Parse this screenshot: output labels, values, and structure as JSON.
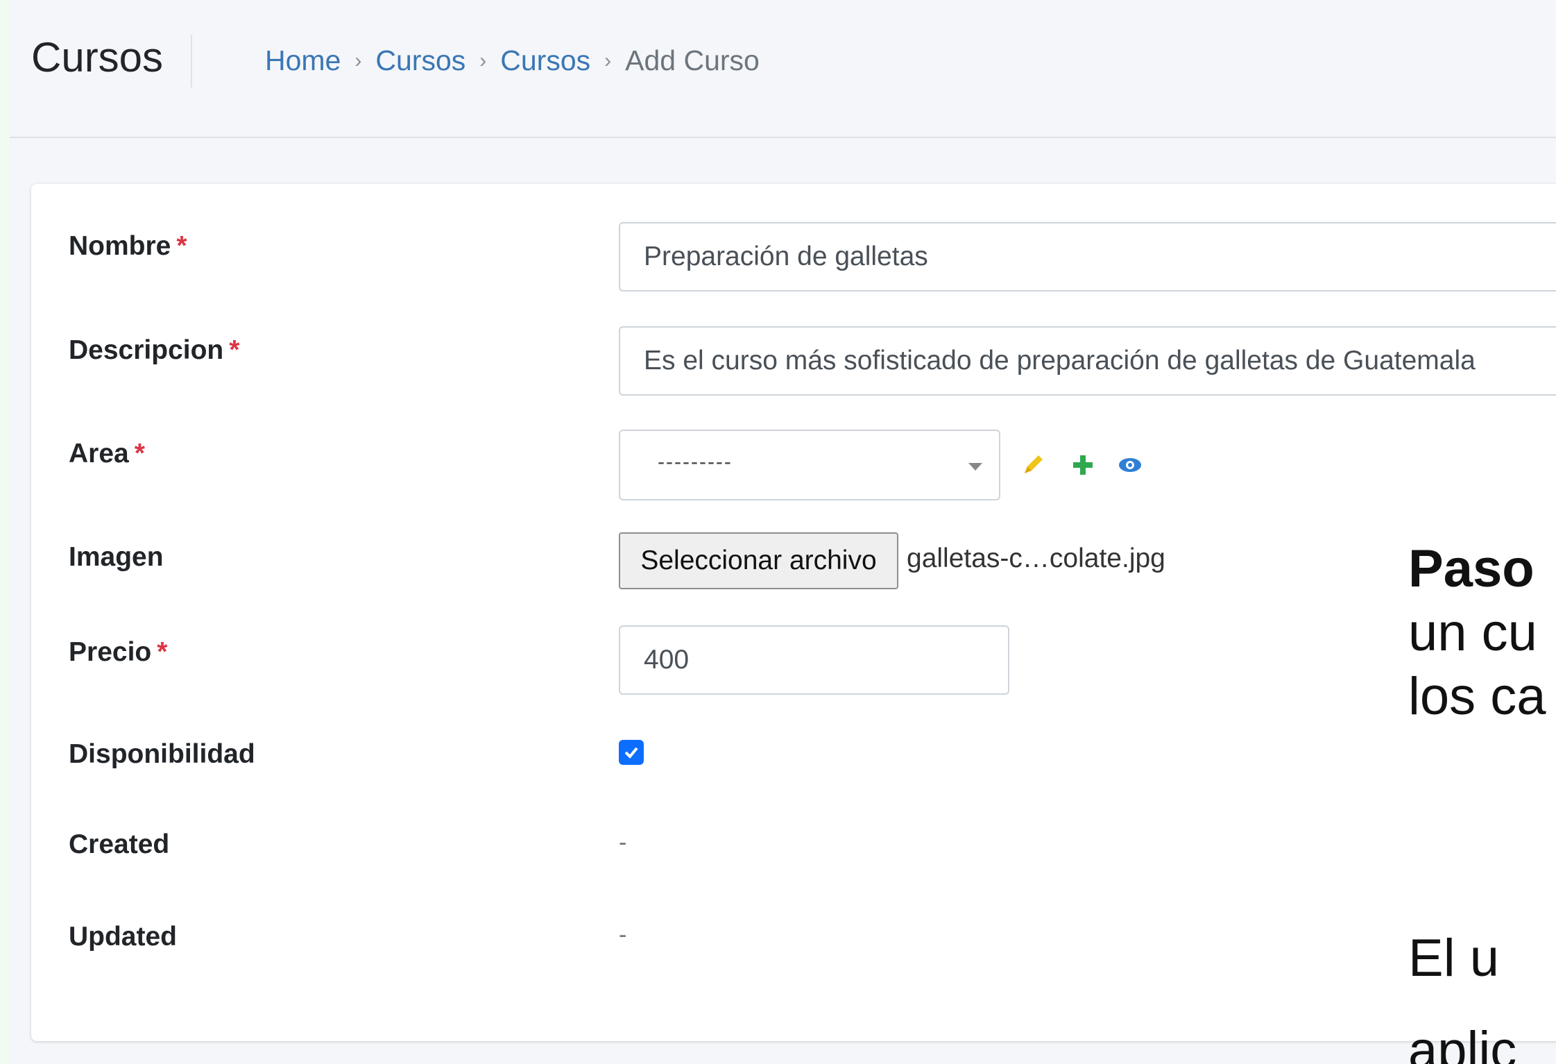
{
  "header": {
    "title": "Cursos",
    "breadcrumb": [
      {
        "label": "Home",
        "link": true
      },
      {
        "label": "Cursos",
        "link": true
      },
      {
        "label": "Cursos",
        "link": true
      },
      {
        "label": "Add Curso",
        "link": false
      }
    ],
    "separator": "›"
  },
  "form": {
    "nombre": {
      "label": "Nombre",
      "value": "Preparación de galletas",
      "required": "*"
    },
    "descripcion": {
      "label": "Descripcion",
      "value": "Es el curso más sofisticado de preparación de galletas de Guatemala",
      "required": "*"
    },
    "area": {
      "label": "Area",
      "value": "---------",
      "required": "*",
      "actions": [
        "edit-icon",
        "add-icon",
        "view-icon"
      ]
    },
    "imagen": {
      "label": "Imagen",
      "button": "Seleccionar archivo",
      "file": "galletas-c…colate.jpg"
    },
    "precio": {
      "label": "Precio",
      "value": "400",
      "required": "*"
    },
    "disponibilidad": {
      "label": "Disponibilidad",
      "checked": true
    },
    "created": {
      "label": "Created",
      "value": "-"
    },
    "updated": {
      "label": "Updated",
      "value": "-"
    }
  },
  "overlay": {
    "line1": "Paso",
    "line2": "un cu",
    "line3": "los ca",
    "line4": "El  u",
    "line5": "aplic"
  },
  "colors": {
    "link": "#3a76b4",
    "required": "#dc3545",
    "checkbox": "#0d6efd",
    "edit_icon": "#f0c419",
    "add_icon": "#2fa84f",
    "view_icon": "#2f7fd6"
  }
}
